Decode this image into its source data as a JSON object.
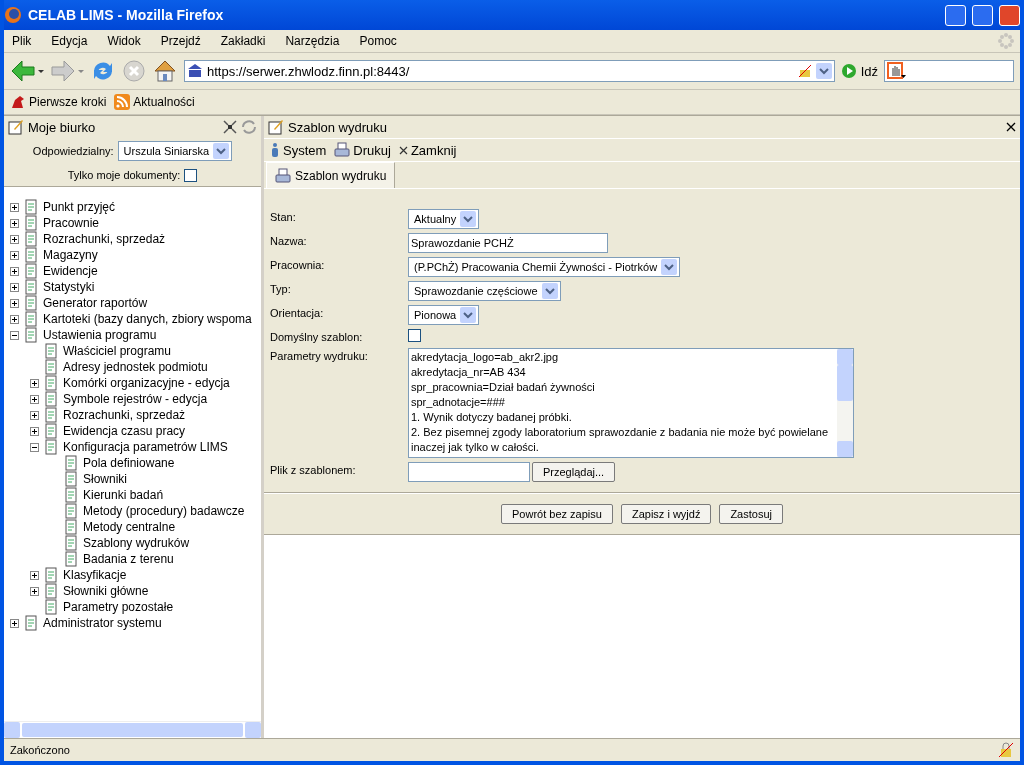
{
  "window": {
    "title": "CELAB LIMS - Mozilla Firefox"
  },
  "menu": [
    "Plik",
    "Edycja",
    "Widok",
    "Przejdź",
    "Zakładki",
    "Narzędzia",
    "Pomoc"
  ],
  "address": {
    "value": "https://serwer.zhwlodz.finn.pl:8443/"
  },
  "go_label": "Idź",
  "bookmarks": [
    "Pierwsze kroki",
    "Aktualności"
  ],
  "sidebar": {
    "title": "Moje biurko",
    "responsible_label": "Odpowiedzialny:",
    "responsible_value": "Urszula Siniarska",
    "only_mine_label": "Tylko moje dokumenty:",
    "only_mine_checked": false,
    "tree": [
      {
        "label": "Punkt przyjęć",
        "expanded": false
      },
      {
        "label": "Pracownie",
        "expanded": false
      },
      {
        "label": "Rozrachunki, sprzedaż",
        "expanded": false
      },
      {
        "label": "Magazyny",
        "expanded": false
      },
      {
        "label": "Ewidencje",
        "expanded": false
      },
      {
        "label": "Statystyki",
        "expanded": false
      },
      {
        "label": "Generator raportów",
        "expanded": false
      },
      {
        "label": "Kartoteki (bazy danych, zbiory wspoma",
        "expanded": false
      },
      {
        "label": "Ustawienia programu",
        "expanded": true,
        "children": [
          {
            "label": "Właściciel programu"
          },
          {
            "label": "Adresy jednostek podmiotu"
          },
          {
            "label": "Komórki organizacyjne - edycja",
            "expanded": false
          },
          {
            "label": "Symbole rejestrów - edycja",
            "expanded": false
          },
          {
            "label": "Rozrachunki, sprzedaż",
            "expanded": false
          },
          {
            "label": "Ewidencja czasu pracy",
            "expanded": false
          },
          {
            "label": "Konfiguracja parametrów LIMS",
            "expanded": true,
            "children": [
              {
                "label": "Pola definiowane"
              },
              {
                "label": "Słowniki"
              },
              {
                "label": "Kierunki badań"
              },
              {
                "label": "Metody (procedury) badawcze"
              },
              {
                "label": "Metody centralne"
              },
              {
                "label": "Szablony wydruków"
              },
              {
                "label": "Badania z terenu"
              }
            ]
          },
          {
            "label": "Klasyfikacje",
            "expanded": false
          },
          {
            "label": "Słowniki główne",
            "expanded": false
          },
          {
            "label": "Parametry pozostałe"
          }
        ]
      },
      {
        "label": "Administrator systemu",
        "expanded": false
      }
    ]
  },
  "panel": {
    "title": "Szablon wydruku",
    "toolbar": [
      "System",
      "Drukuj",
      "Zamknij"
    ],
    "tabs": [
      {
        "label": "Szablon wydruku",
        "selected": true
      }
    ],
    "fields": [
      {
        "label": "Stan:",
        "kind": "select",
        "value": "Aktualny"
      },
      {
        "label": "Nazwa:",
        "kind": "text",
        "value": "Sprawozdanie PCHŻ"
      },
      {
        "label": "Pracownia:",
        "kind": "select",
        "value": "(P.PChŻ) Pracowania Chemii Żywności - Piotrków"
      },
      {
        "label": "Typ:",
        "kind": "select",
        "value": "Sprawozdanie częściowe"
      },
      {
        "label": "Orientacja:",
        "kind": "select",
        "value": "Pionowa"
      },
      {
        "label": "Domyślny szablon:",
        "kind": "checkbox",
        "checked": false
      },
      {
        "label": "Parametry wydruku:",
        "kind": "textarea",
        "lines": [
          "akredytacja_logo=ab_akr2.jpg",
          "akredytacja_nr=AB 434",
          "spr_pracownia=Dział badań żywności",
          "spr_adnotacje=###",
          "1. Wynik dotyczy badanej próbki.",
          "2. Bez pisemnej zgody laboratorium sprawozdanie z badania nie może być powielane",
          "inaczej jak tylko w całości."
        ]
      },
      {
        "label": "Plik z szablonem:",
        "kind": "file",
        "button": "Przeglądaj..."
      }
    ],
    "buttons": [
      "Powrót bez zapisu",
      "Zapisz i wyjdź",
      "Zastosuj"
    ]
  },
  "status_bar": {
    "text": "Zakończono"
  }
}
